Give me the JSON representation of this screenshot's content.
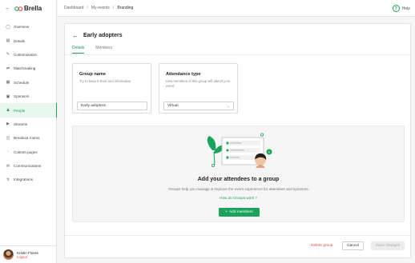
{
  "brand": {
    "name": "Brella",
    "accent": "#1aa35a"
  },
  "sidebar": {
    "items": [
      {
        "label": "Overview",
        "icon": "overview-icon"
      },
      {
        "label": "Details",
        "icon": "details-icon"
      },
      {
        "label": "Customization",
        "icon": "customization-icon"
      },
      {
        "label": "Matchmaking",
        "icon": "matchmaking-icon"
      },
      {
        "label": "Schedule",
        "icon": "schedule-icon"
      },
      {
        "label": "Sponsors",
        "icon": "sponsors-icon"
      },
      {
        "label": "People",
        "icon": "people-icon",
        "active": true
      },
      {
        "label": "Streams",
        "icon": "streams-icon"
      },
      {
        "label": "Breakout rooms",
        "icon": "breakout-rooms-icon"
      },
      {
        "label": "Custom pages",
        "icon": "custom-pages-icon"
      },
      {
        "label": "Communications",
        "icon": "communications-icon"
      },
      {
        "label": "Integrations",
        "icon": "integrations-icon"
      }
    ],
    "user": {
      "name": "Kristin Flores",
      "logout": "Logout"
    }
  },
  "header": {
    "breadcrumb": [
      "Dashboard",
      "My-events",
      "Branding"
    ],
    "help": "Help"
  },
  "main": {
    "title": "Early adopters",
    "tabs": [
      {
        "label": "Details",
        "active": true
      },
      {
        "label": "Members",
        "active": false
      }
    ],
    "group_name": {
      "title": "Group name",
      "help": "Try to keep it short and informative",
      "value": "Early adopters"
    },
    "attendance_type": {
      "title": "Attendance type",
      "help": "How members of this group will attend your event",
      "value": "Virtual"
    },
    "empty_state": {
      "title": "Add your attendees to a group",
      "description": "Groups help you manage & improve the event experience for attendees and sponsors",
      "link": "How do Groups work ?",
      "button": "Add members"
    },
    "footer": {
      "delete": "Delete group",
      "cancel": "Cancel",
      "save": "Save changes"
    }
  }
}
